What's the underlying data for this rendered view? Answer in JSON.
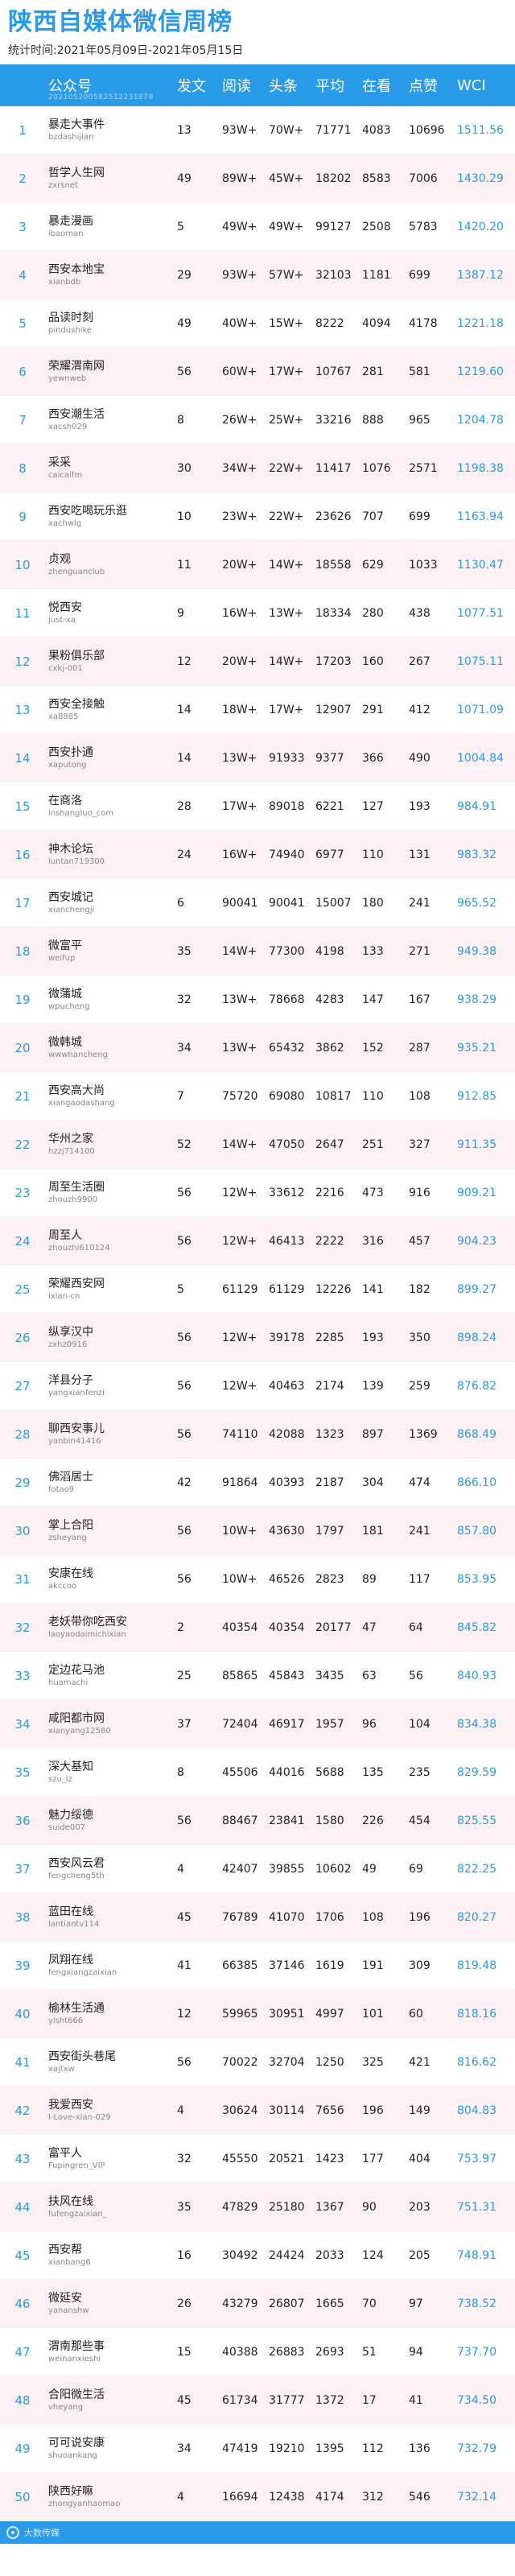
{
  "header": {
    "title": "陕西自媒体微信周榜",
    "period": "统计时间:2021年05月09日-2021年05月15日"
  },
  "table": {
    "columns": [
      "公众号",
      "发文",
      "阅读",
      "头条",
      "平均",
      "在看",
      "点赞",
      "WCI"
    ],
    "header_sub": "202105200582512231879",
    "rows": [
      {
        "rank": "1",
        "name": "暴走大事件",
        "wxid": "bzdashijian",
        "posts": "13",
        "reads": "93W+",
        "head": "70W+",
        "avg": "71771",
        "watch": "4083",
        "likes": "10696",
        "wci": "1511.56"
      },
      {
        "rank": "2",
        "name": "哲学人生网",
        "wxid": "zxrsnet",
        "posts": "49",
        "reads": "89W+",
        "head": "45W+",
        "avg": "18202",
        "watch": "8583",
        "likes": "7006",
        "wci": "1430.29"
      },
      {
        "rank": "3",
        "name": "暴走漫画",
        "wxid": "ibaoman",
        "posts": "5",
        "reads": "49W+",
        "head": "49W+",
        "avg": "99127",
        "watch": "2508",
        "likes": "5783",
        "wci": "1420.20"
      },
      {
        "rank": "4",
        "name": "西安本地宝",
        "wxid": "xianbdb",
        "posts": "29",
        "reads": "93W+",
        "head": "57W+",
        "avg": "32103",
        "watch": "1181",
        "likes": "699",
        "wci": "1387.12"
      },
      {
        "rank": "5",
        "name": "品读时刻",
        "wxid": "pindushike",
        "posts": "49",
        "reads": "40W+",
        "head": "15W+",
        "avg": "8222",
        "watch": "4094",
        "likes": "4178",
        "wci": "1221.18"
      },
      {
        "rank": "6",
        "name": "荣耀渭南网",
        "wxid": "yewnweb",
        "posts": "56",
        "reads": "60W+",
        "head": "17W+",
        "avg": "10767",
        "watch": "281",
        "likes": "581",
        "wci": "1219.60"
      },
      {
        "rank": "7",
        "name": "西安潮生活",
        "wxid": "xacsh029",
        "posts": "8",
        "reads": "26W+",
        "head": "25W+",
        "avg": "33216",
        "watch": "888",
        "likes": "965",
        "wci": "1204.78"
      },
      {
        "rank": "8",
        "name": "采采",
        "wxid": "caicaifm",
        "posts": "30",
        "reads": "34W+",
        "head": "22W+",
        "avg": "11417",
        "watch": "1076",
        "likes": "2571",
        "wci": "1198.38"
      },
      {
        "rank": "9",
        "name": "西安吃喝玩乐逛",
        "wxid": "xachwlg",
        "posts": "10",
        "reads": "23W+",
        "head": "22W+",
        "avg": "23626",
        "watch": "707",
        "likes": "699",
        "wci": "1163.94"
      },
      {
        "rank": "10",
        "name": "贞观",
        "wxid": "zhenguanclub",
        "posts": "11",
        "reads": "20W+",
        "head": "14W+",
        "avg": "18558",
        "watch": "629",
        "likes": "1033",
        "wci": "1130.47"
      },
      {
        "rank": "11",
        "name": "悦西安",
        "wxid": "just-xa",
        "posts": "9",
        "reads": "16W+",
        "head": "13W+",
        "avg": "18334",
        "watch": "280",
        "likes": "438",
        "wci": "1077.51"
      },
      {
        "rank": "12",
        "name": "果粉俱乐部",
        "wxid": "cxkj-001",
        "posts": "12",
        "reads": "20W+",
        "head": "14W+",
        "avg": "17203",
        "watch": "160",
        "likes": "267",
        "wci": "1075.11"
      },
      {
        "rank": "13",
        "name": "西安全接触",
        "wxid": "xa8885",
        "posts": "14",
        "reads": "18W+",
        "head": "17W+",
        "avg": "12907",
        "watch": "291",
        "likes": "412",
        "wci": "1071.09"
      },
      {
        "rank": "14",
        "name": "西安扑通",
        "wxid": "xaputong",
        "posts": "14",
        "reads": "13W+",
        "head": "91933",
        "avg": "9377",
        "watch": "366",
        "likes": "490",
        "wci": "1004.84"
      },
      {
        "rank": "15",
        "name": "在商洛",
        "wxid": "inshangluo_com",
        "posts": "28",
        "reads": "17W+",
        "head": "89018",
        "avg": "6221",
        "watch": "127",
        "likes": "193",
        "wci": "984.91"
      },
      {
        "rank": "16",
        "name": "神木论坛",
        "wxid": "luntan719300",
        "posts": "24",
        "reads": "16W+",
        "head": "74940",
        "avg": "6977",
        "watch": "110",
        "likes": "131",
        "wci": "983.32"
      },
      {
        "rank": "17",
        "name": "西安城记",
        "wxid": "xianchengji",
        "posts": "6",
        "reads": "90041",
        "head": "90041",
        "avg": "15007",
        "watch": "180",
        "likes": "241",
        "wci": "965.52"
      },
      {
        "rank": "18",
        "name": "微富平",
        "wxid": "weifup",
        "posts": "35",
        "reads": "14W+",
        "head": "77300",
        "avg": "4198",
        "watch": "133",
        "likes": "271",
        "wci": "949.38"
      },
      {
        "rank": "19",
        "name": "微蒲城",
        "wxid": "wpucheng",
        "posts": "32",
        "reads": "13W+",
        "head": "78668",
        "avg": "4283",
        "watch": "147",
        "likes": "167",
        "wci": "938.29"
      },
      {
        "rank": "20",
        "name": "微韩城",
        "wxid": "wwwhancheng",
        "posts": "34",
        "reads": "13W+",
        "head": "65432",
        "avg": "3862",
        "watch": "152",
        "likes": "287",
        "wci": "935.21"
      },
      {
        "rank": "21",
        "name": "西安高大尚",
        "wxid": "xiangaodashang",
        "posts": "7",
        "reads": "75720",
        "head": "69080",
        "avg": "10817",
        "watch": "110",
        "likes": "108",
        "wci": "912.85"
      },
      {
        "rank": "22",
        "name": "华州之家",
        "wxid": "hzzj714100",
        "posts": "52",
        "reads": "14W+",
        "head": "47050",
        "avg": "2647",
        "watch": "251",
        "likes": "327",
        "wci": "911.35"
      },
      {
        "rank": "23",
        "name": "周至生活圈",
        "wxid": "zhouzh9900",
        "posts": "56",
        "reads": "12W+",
        "head": "33612",
        "avg": "2216",
        "watch": "473",
        "likes": "916",
        "wci": "909.21"
      },
      {
        "rank": "24",
        "name": "周至人",
        "wxid": "zhouzhi610124",
        "posts": "56",
        "reads": "12W+",
        "head": "46413",
        "avg": "2222",
        "watch": "316",
        "likes": "457",
        "wci": "904.23"
      },
      {
        "rank": "25",
        "name": "荣耀西安网",
        "wxid": "ixian-cn",
        "posts": "5",
        "reads": "61129",
        "head": "61129",
        "avg": "12226",
        "watch": "141",
        "likes": "182",
        "wci": "899.27"
      },
      {
        "rank": "26",
        "name": "纵享汉中",
        "wxid": "zxhz0916",
        "posts": "56",
        "reads": "12W+",
        "head": "39178",
        "avg": "2285",
        "watch": "193",
        "likes": "350",
        "wci": "898.24"
      },
      {
        "rank": "27",
        "name": "洋县分子",
        "wxid": "yangxianfenzi",
        "posts": "56",
        "reads": "12W+",
        "head": "40463",
        "avg": "2174",
        "watch": "139",
        "likes": "259",
        "wci": "876.82"
      },
      {
        "rank": "28",
        "name": "聊西安事儿",
        "wxid": "yanbin41416",
        "posts": "56",
        "reads": "74110",
        "head": "42088",
        "avg": "1323",
        "watch": "897",
        "likes": "1369",
        "wci": "868.49"
      },
      {
        "rank": "29",
        "name": "佛滔居士",
        "wxid": "fotao9",
        "posts": "42",
        "reads": "91864",
        "head": "40393",
        "avg": "2187",
        "watch": "304",
        "likes": "474",
        "wci": "866.10"
      },
      {
        "rank": "30",
        "name": "掌上合阳",
        "wxid": "zsheyang",
        "posts": "56",
        "reads": "10W+",
        "head": "43630",
        "avg": "1797",
        "watch": "181",
        "likes": "241",
        "wci": "857.80"
      },
      {
        "rank": "31",
        "name": "安康在线",
        "wxid": "akccoo",
        "posts": "56",
        "reads": "10W+",
        "head": "46526",
        "avg": "2823",
        "watch": "89",
        "likes": "117",
        "wci": "853.95"
      },
      {
        "rank": "32",
        "name": "老妖带你吃西安",
        "wxid": "laoyaodaimichixian",
        "posts": "2",
        "reads": "40354",
        "head": "40354",
        "avg": "20177",
        "watch": "47",
        "likes": "64",
        "wci": "845.82"
      },
      {
        "rank": "33",
        "name": "定边花马池",
        "wxid": "huamachi",
        "posts": "25",
        "reads": "85865",
        "head": "45843",
        "avg": "3435",
        "watch": "63",
        "likes": "56",
        "wci": "840.93"
      },
      {
        "rank": "34",
        "name": "咸阳都市网",
        "wxid": "xianyang12580",
        "posts": "37",
        "reads": "72404",
        "head": "46917",
        "avg": "1957",
        "watch": "96",
        "likes": "104",
        "wci": "834.38"
      },
      {
        "rank": "35",
        "name": "深大基知",
        "wxid": "szu_lz",
        "posts": "8",
        "reads": "45506",
        "head": "44016",
        "avg": "5688",
        "watch": "135",
        "likes": "235",
        "wci": "829.59"
      },
      {
        "rank": "36",
        "name": "魅力绥德",
        "wxid": "suide007",
        "posts": "56",
        "reads": "88467",
        "head": "23841",
        "avg": "1580",
        "watch": "226",
        "likes": "454",
        "wci": "825.55"
      },
      {
        "rank": "37",
        "name": "西安风云君",
        "wxid": "fengcheng5th",
        "posts": "4",
        "reads": "42407",
        "head": "39855",
        "avg": "10602",
        "watch": "49",
        "likes": "69",
        "wci": "822.25"
      },
      {
        "rank": "38",
        "name": "蓝田在线",
        "wxid": "lantiantv114",
        "posts": "45",
        "reads": "76789",
        "head": "41070",
        "avg": "1706",
        "watch": "108",
        "likes": "196",
        "wci": "820.27"
      },
      {
        "rank": "39",
        "name": "凤翔在线",
        "wxid": "fengxiangzaixian",
        "posts": "41",
        "reads": "66385",
        "head": "37146",
        "avg": "1619",
        "watch": "191",
        "likes": "309",
        "wci": "819.48"
      },
      {
        "rank": "40",
        "name": "榆林生活通",
        "wxid": "ylsht666",
        "posts": "12",
        "reads": "59965",
        "head": "30951",
        "avg": "4997",
        "watch": "101",
        "likes": "60",
        "wci": "818.16"
      },
      {
        "rank": "41",
        "name": "西安街头巷尾",
        "wxid": "xajtxw",
        "posts": "56",
        "reads": "70022",
        "head": "32704",
        "avg": "1250",
        "watch": "325",
        "likes": "421",
        "wci": "816.62"
      },
      {
        "rank": "42",
        "name": "我爱西安",
        "wxid": "I-Love-xian-029",
        "posts": "4",
        "reads": "30624",
        "head": "30114",
        "avg": "7656",
        "watch": "196",
        "likes": "149",
        "wci": "804.83"
      },
      {
        "rank": "43",
        "name": "富平人",
        "wxid": "Fupingren_VIP",
        "posts": "32",
        "reads": "45550",
        "head": "20521",
        "avg": "1423",
        "watch": "177",
        "likes": "404",
        "wci": "753.97"
      },
      {
        "rank": "44",
        "name": "扶风在线",
        "wxid": "fufengzaixian_",
        "posts": "35",
        "reads": "47829",
        "head": "25180",
        "avg": "1367",
        "watch": "90",
        "likes": "203",
        "wci": "751.31"
      },
      {
        "rank": "45",
        "name": "西安帮",
        "wxid": "xianbang6",
        "posts": "16",
        "reads": "30492",
        "head": "24424",
        "avg": "2033",
        "watch": "124",
        "likes": "205",
        "wci": "748.91"
      },
      {
        "rank": "46",
        "name": "微延安",
        "wxid": "yananshw",
        "posts": "26",
        "reads": "43279",
        "head": "26807",
        "avg": "1665",
        "watch": "70",
        "likes": "97",
        "wci": "738.52"
      },
      {
        "rank": "47",
        "name": "渭南那些事",
        "wxid": "weinanxieshi",
        "posts": "15",
        "reads": "40388",
        "head": "26883",
        "avg": "2693",
        "watch": "51",
        "likes": "94",
        "wci": "737.70"
      },
      {
        "rank": "48",
        "name": "合阳微生活",
        "wxid": "vheyang",
        "posts": "45",
        "reads": "61734",
        "head": "31777",
        "avg": "1372",
        "watch": "17",
        "likes": "41",
        "wci": "734.50"
      },
      {
        "rank": "49",
        "name": "可可说安康",
        "wxid": "shuoankang",
        "posts": "34",
        "reads": "47419",
        "head": "19210",
        "avg": "1395",
        "watch": "112",
        "likes": "136",
        "wci": "732.79"
      },
      {
        "rank": "50",
        "name": "陕西好嘛",
        "wxid": "zhongyanhaomao",
        "posts": "4",
        "reads": "16694",
        "head": "12438",
        "avg": "4174",
        "watch": "312",
        "likes": "546",
        "wci": "732.14"
      }
    ]
  },
  "footer": {
    "brand": "大数传媒"
  },
  "colors": {
    "accent": "#2a9be8",
    "alt_row": "#fdf1f3"
  }
}
